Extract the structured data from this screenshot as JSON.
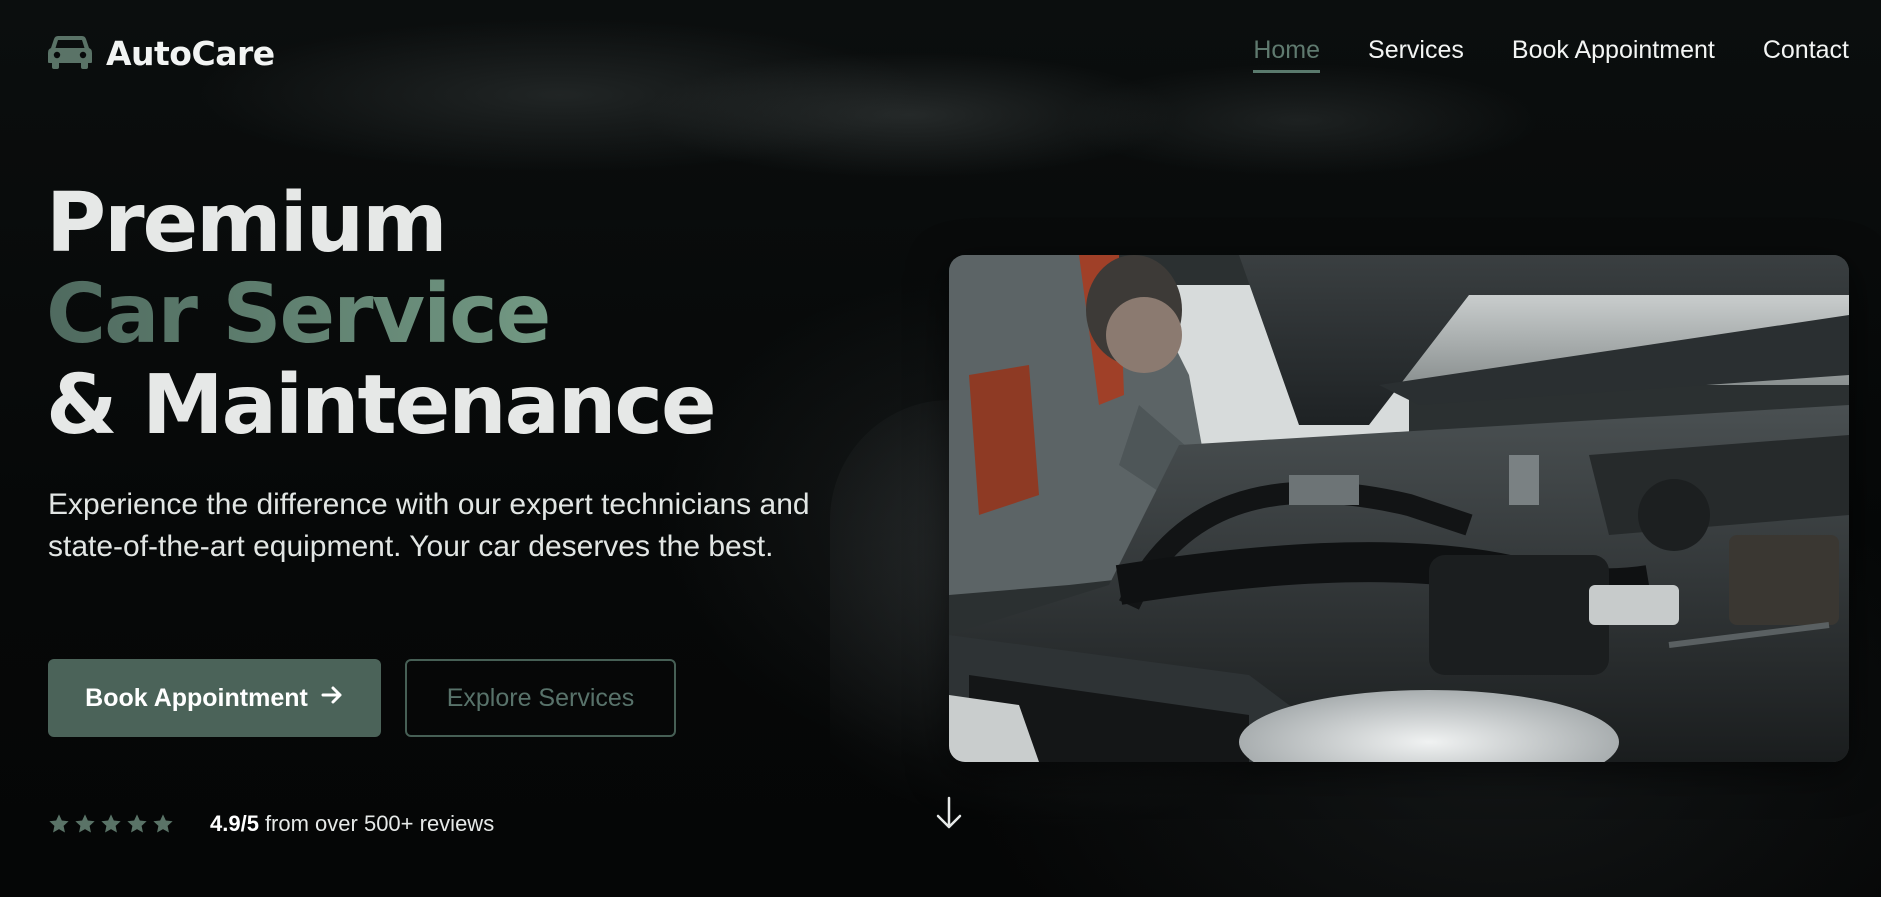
{
  "brand": {
    "name": "AutoCare",
    "icon": "car-icon"
  },
  "nav": [
    {
      "label": "Home",
      "active": true
    },
    {
      "label": "Services",
      "active": false
    },
    {
      "label": "Book Appointment",
      "active": false
    },
    {
      "label": "Contact",
      "active": false
    }
  ],
  "hero": {
    "title_line1": "Premium",
    "title_line2": "Car Service",
    "title_line3": "& Maintenance",
    "subtitle": "Experience the difference with our expert technicians and state-of-the-art equipment. Your car deserves the best.",
    "primary_button": "Book Appointment",
    "primary_button_icon": "arrow-right-icon",
    "secondary_button": "Explore Services",
    "image_alt": "mechanic-working-on-engine-photo"
  },
  "rating": {
    "stars": 5,
    "score": "4.9/5",
    "text": "from over 500+ reviews"
  },
  "scroll_icon": "arrow-down-icon",
  "colors": {
    "accent": "#4b6359",
    "accent_light": "#7ea88f",
    "nav_active": "#5f7a6f",
    "background": "#07090a",
    "text": "#e6e8e7"
  }
}
